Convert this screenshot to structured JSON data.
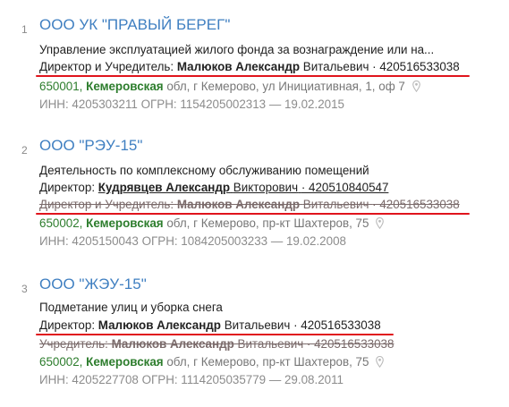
{
  "colors": {
    "title": "#3f7fc1",
    "address_green": "#2d7d2d",
    "underline_red": "#e0141c"
  },
  "results": [
    {
      "index": "1",
      "name": "ООО УК \"ПРАВЫЙ БЕРЕГ\"",
      "activity": "Управление эксплуатацией жилого фонда за вознаграждение или на...",
      "person": {
        "role": "Директор и Учредитель:",
        "surname_name": "Малюков Александр",
        "patronymic": "Витальевич",
        "inn": "· 420516533038"
      },
      "address": {
        "postcode": "650001,",
        "region": "Кемеровская",
        "rest": "обл, г Кемерово, ул Инициативная, 1, оф 7"
      },
      "ids": "ИНН: 4205303211    ОГРН: 1154205002313 — 19.02.2015"
    },
    {
      "index": "2",
      "name": "ООО \"РЭУ-15\"",
      "activity": "Деятельность по комплексному обслуживанию помещений",
      "person": {
        "role": "Директор:",
        "surname_name": "Кудрявцев Александр",
        "patronymic": "Викторович",
        "inn": "· 420510840547"
      },
      "former_person": {
        "role": "Директор и Учредитель:",
        "surname_name": "Малюков Александр",
        "patronymic": "Витальевич",
        "inn": "· 420516533038"
      },
      "address": {
        "postcode": "650002,",
        "region": "Кемеровская",
        "rest": "обл, г Кемерово, пр-кт Шахтеров, 75"
      },
      "ids": "ИНН: 4205150043    ОГРН: 1084205003233 — 19.02.2008"
    },
    {
      "index": "3",
      "name": "ООО \"ЖЭУ-15\"",
      "activity": "Подметание улиц и уборка снега",
      "person": {
        "role": "Директор:",
        "surname_name": "Малюков Александр",
        "patronymic": "Витальевич",
        "inn": "· 420516533038"
      },
      "former_person": {
        "role": "Учредитель:",
        "surname_name": "Малюков Александр",
        "patronymic": "Витальевич",
        "inn": "· 420516533038"
      },
      "address": {
        "postcode": "650002,",
        "region": "Кемеровская",
        "rest": "обл, г Кемерово, пр-кт Шахтеров, 75"
      },
      "ids": "ИНН: 4205227708    ОГРН: 1114205035779 — 29.08.2011"
    }
  ]
}
